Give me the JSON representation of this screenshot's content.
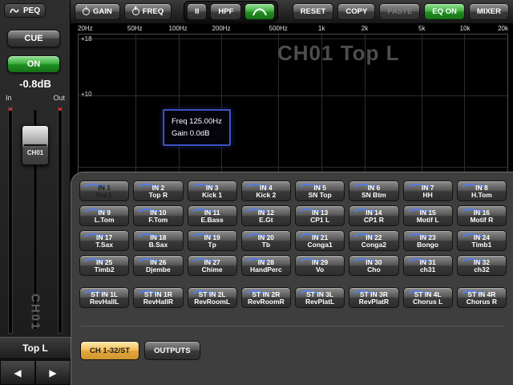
{
  "colors": {
    "selected_orange": "#f4c05a",
    "on_green": "#2e9e2e",
    "eq_curve_blue": "#4a7dff"
  },
  "sidebar": {
    "peq_label": "PEQ",
    "cue_label": "CUE",
    "on_label": "ON",
    "level_value": "-0.8dB",
    "meter_in_label": "In",
    "meter_out_label": "Out",
    "fader_label": "CH01",
    "channel_id_watermark": "CH01",
    "channel_name": "Top L",
    "prev_arrow": "◀",
    "next_arrow": "▶"
  },
  "toolbar": {
    "gain_label": "GAIN",
    "freq_label": "FREQ",
    "band_label": "II",
    "hpf_label": "HPF",
    "reset_label": "RESET",
    "copy_label": "COPY",
    "paste_label": "PASTE",
    "eq_on_label": "EQ ON",
    "mixer_label": "MIXER"
  },
  "eq_graph": {
    "watermark": "CH01 Top L",
    "freq_ticks": [
      "20Hz",
      "50Hz",
      "100Hz",
      "200Hz",
      "500Hz",
      "1k",
      "2k",
      "5k",
      "10k",
      "20k"
    ],
    "freq_values": [
      20,
      50,
      100,
      200,
      500,
      1000,
      2000,
      5000,
      10000,
      20000
    ],
    "gain_labels": [
      "+18",
      "+10"
    ],
    "tooltip_freq": "Freq  125.00Hz",
    "tooltip_gain": "Gain  0.0dB"
  },
  "channel_panel": {
    "channels": [
      {
        "id": "IN 1",
        "name": "Top L",
        "selected": true
      },
      {
        "id": "IN 2",
        "name": "Top R",
        "selected": false
      },
      {
        "id": "IN 3",
        "name": "Kick 1",
        "selected": false
      },
      {
        "id": "IN 4",
        "name": "Kick 2",
        "selected": false
      },
      {
        "id": "IN 5",
        "name": "SN Top",
        "selected": false
      },
      {
        "id": "IN 6",
        "name": "SN Btm",
        "selected": false
      },
      {
        "id": "IN 7",
        "name": "HH",
        "selected": false
      },
      {
        "id": "IN 8",
        "name": "H.Tom",
        "selected": false
      },
      {
        "id": "IN 9",
        "name": "L.Tom",
        "selected": false
      },
      {
        "id": "IN 10",
        "name": "F.Tom",
        "selected": false
      },
      {
        "id": "IN 11",
        "name": "E.Bass",
        "selected": false
      },
      {
        "id": "IN 12",
        "name": "E.Gt",
        "selected": false
      },
      {
        "id": "IN 13",
        "name": "CP1 L",
        "selected": false
      },
      {
        "id": "IN 14",
        "name": "CP1 R",
        "selected": false
      },
      {
        "id": "IN 15",
        "name": "Motif L",
        "selected": false
      },
      {
        "id": "IN 16",
        "name": "Motif R",
        "selected": false
      },
      {
        "id": "IN 17",
        "name": "T.Sax",
        "selected": false
      },
      {
        "id": "IN 18",
        "name": "B.Sax",
        "selected": false
      },
      {
        "id": "IN 19",
        "name": "Tp",
        "selected": false
      },
      {
        "id": "IN 20",
        "name": "Tb",
        "selected": false
      },
      {
        "id": "IN 21",
        "name": "Conga1",
        "selected": false
      },
      {
        "id": "IN 22",
        "name": "Conga2",
        "selected": false
      },
      {
        "id": "IN 23",
        "name": "Bongo",
        "selected": false
      },
      {
        "id": "IN 24",
        "name": "Timb1",
        "selected": false
      },
      {
        "id": "IN 25",
        "name": "Timb2",
        "selected": false
      },
      {
        "id": "IN 26",
        "name": "Djembe",
        "selected": false
      },
      {
        "id": "IN 27",
        "name": "Chime",
        "selected": false
      },
      {
        "id": "IN 28",
        "name": "HandPerc",
        "selected": false
      },
      {
        "id": "IN 29",
        "name": "Vo",
        "selected": false
      },
      {
        "id": "IN 30",
        "name": "Cho",
        "selected": false
      },
      {
        "id": "IN 31",
        "name": "ch31",
        "selected": false
      },
      {
        "id": "IN 32",
        "name": "ch32",
        "selected": false
      },
      {
        "id": "ST IN 1L",
        "name": "RevHallL",
        "selected": false
      },
      {
        "id": "ST IN 1R",
        "name": "RevHallR",
        "selected": false
      },
      {
        "id": "ST IN 2L",
        "name": "RevRoomL",
        "selected": false
      },
      {
        "id": "ST IN 2R",
        "name": "RevRoomR",
        "selected": false
      },
      {
        "id": "ST IN 3L",
        "name": "RevPlatL",
        "selected": false
      },
      {
        "id": "ST IN 3R",
        "name": "RevPlatR",
        "selected": false
      },
      {
        "id": "ST IN 4L",
        "name": "Chorus L",
        "selected": false
      },
      {
        "id": "ST IN 4R",
        "name": "Chorus R",
        "selected": false
      }
    ],
    "tabs": [
      {
        "label": "CH 1-32/ST",
        "active": true
      },
      {
        "label": "OUTPUTS",
        "active": false
      }
    ]
  }
}
